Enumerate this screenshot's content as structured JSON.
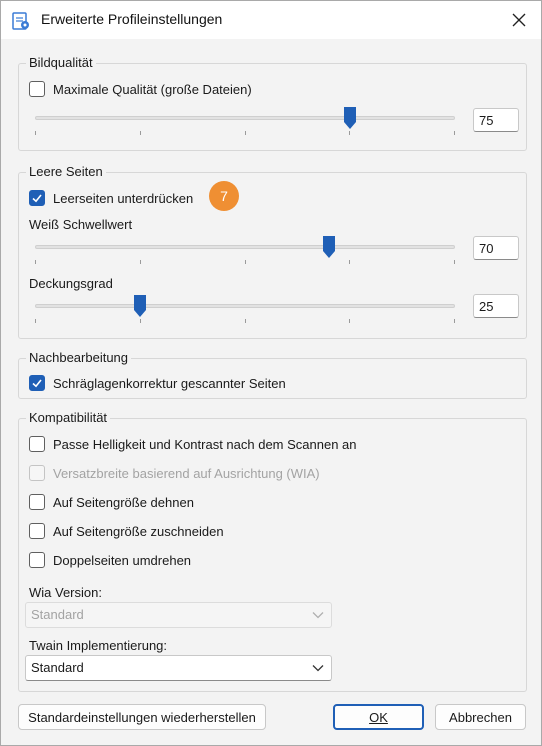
{
  "window": {
    "title": "Erweiterte Profileinstellungen"
  },
  "bildqualitaet": {
    "title": "Bildqualität",
    "max_quality_label": "Maximale Qualität (große Dateien)",
    "max_quality_checked": false,
    "quality_value": "75",
    "quality_level": 0.75
  },
  "leere_seiten": {
    "title": "Leere Seiten",
    "suppress_label": "Leerseiten unterdrücken",
    "suppress_checked": true,
    "badge": "7",
    "threshold_label": "Weiß Schwellwert",
    "threshold_value": "70",
    "threshold_level": 0.7,
    "coverage_label": "Deckungsgrad",
    "coverage_value": "25",
    "coverage_level": 0.25
  },
  "nachbearbeitung": {
    "title": "Nachbearbeitung",
    "deskew_label": "Schräglagenkorrektur gescannter Seiten",
    "deskew_checked": true
  },
  "kompatibilitaet": {
    "title": "Kompatibilität",
    "options": [
      {
        "label": "Passe Helligkeit und Kontrast nach dem Scannen an",
        "checked": false,
        "disabled": false
      },
      {
        "label": "Versatzbreite basierend auf Ausrichtung (WIA)",
        "checked": false,
        "disabled": true
      },
      {
        "label": "Auf Seitengröße dehnen",
        "checked": false,
        "disabled": false
      },
      {
        "label": "Auf Seitengröße zuschneiden",
        "checked": false,
        "disabled": false
      },
      {
        "label": "Doppelseiten umdrehen",
        "checked": false,
        "disabled": false
      }
    ],
    "wia_version_label": "Wia Version:",
    "wia_version_value": "Standard",
    "twain_label": "Twain Implementierung:",
    "twain_value": "Standard"
  },
  "footer": {
    "restore_label": "Standardeinstellungen wiederherstellen",
    "ok_label": "OK",
    "cancel_label": "Abbrechen"
  },
  "colors": {
    "accent": "#1f5fb6",
    "badge": "#ef8f33"
  },
  "icons": [
    "app-icon",
    "close-icon",
    "checkmark-icon",
    "chevron-down-icon"
  ]
}
